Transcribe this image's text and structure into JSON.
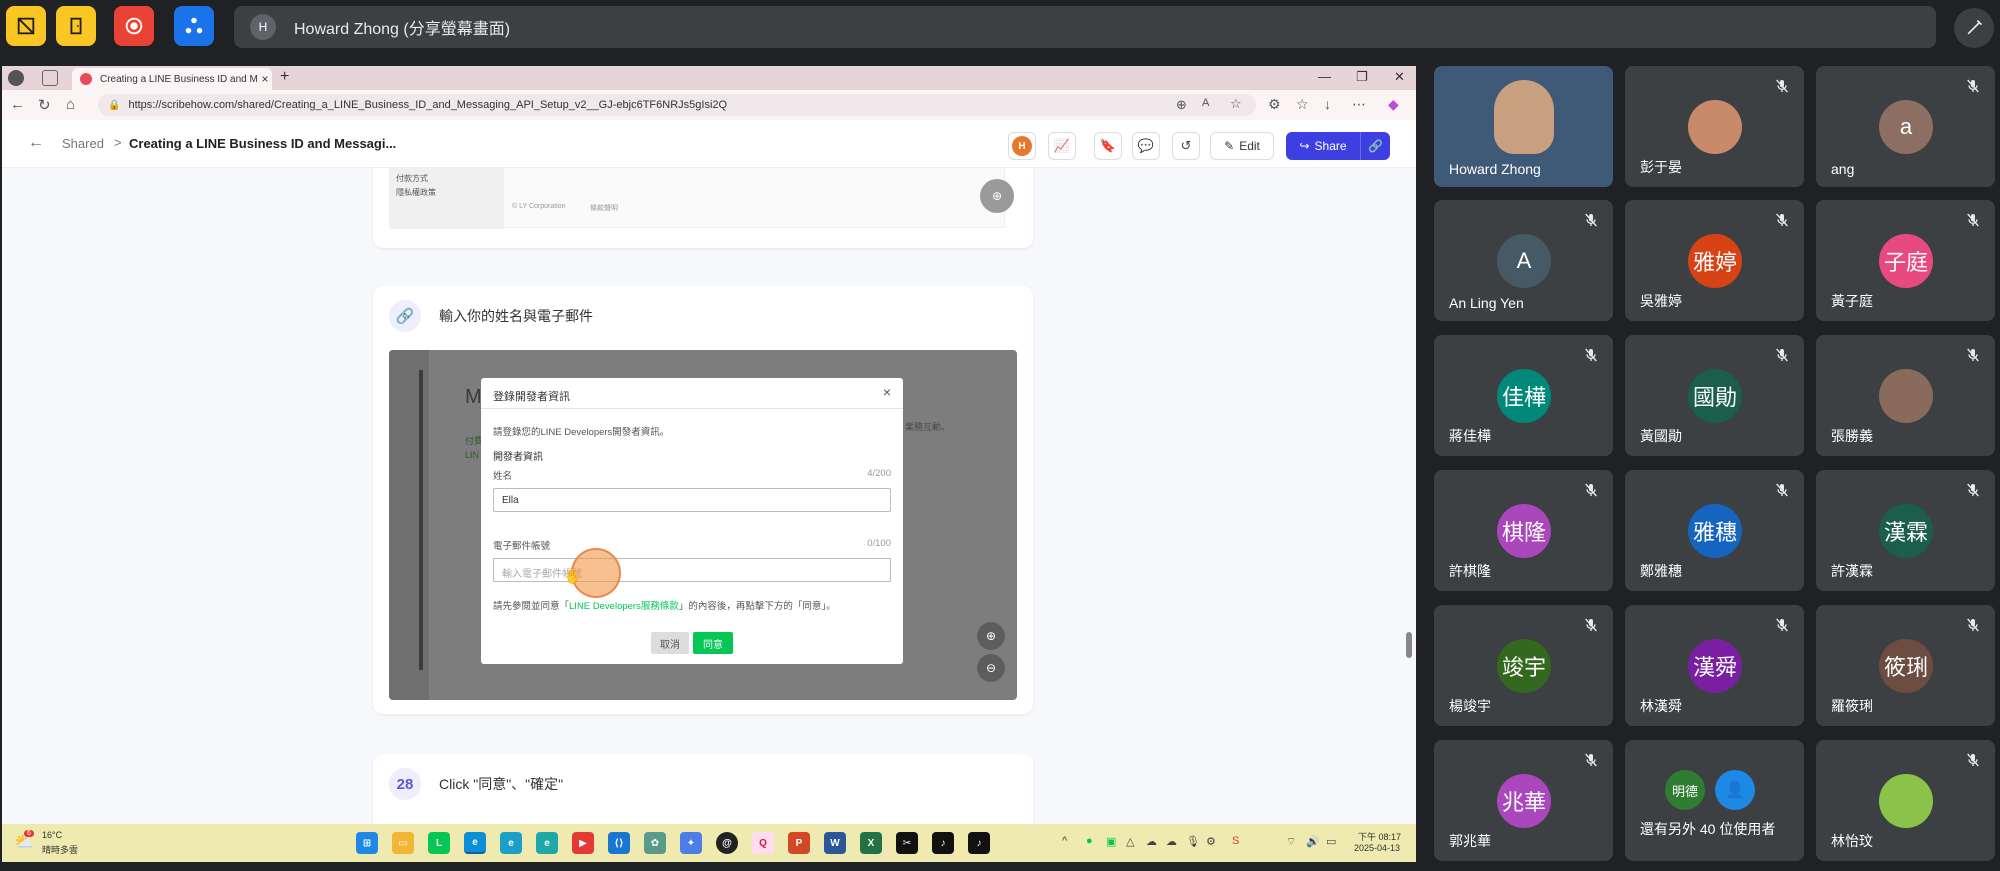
{
  "meet": {
    "presenter": "Howard Zhong (分享螢幕畫面)",
    "presenter_initial": "H"
  },
  "browser": {
    "tab_title": "Creating a LINE Business ID and M",
    "tab_close": "×",
    "new_tab": "+",
    "url": "https://scribehow.com/shared/Creating_a_LINE_Business_ID_and_Messaging_API_Setup_v2__GJ-ebjc6TF6NRJs5gIsi2Q"
  },
  "app": {
    "breadcrumb_root": "Shared",
    "breadcrumb_sep": ">",
    "breadcrumb_title": "Creating a LINE Business ID and Messagi...",
    "user_initial": "H",
    "edit_label": "Edit",
    "share_label": "Share"
  },
  "prev_step": {
    "line1": "付款方式",
    "line2": "隱私權政策",
    "line3": "© LY Corporation",
    "line4": "條款聲明"
  },
  "step_link": {
    "text": "輸入你的姓名與電子郵件"
  },
  "dialog": {
    "title": "登錄開發者資訊",
    "close": "×",
    "intro": "請登錄您的LINE Developers開發者資訊。",
    "section": "開發者資訊",
    "name_label": "姓名",
    "name_count": "4/200",
    "name_value": "Ella",
    "email_label": "電子郵件帳號",
    "email_count": "0/100",
    "email_placeholder": "輸入電子郵件帳號",
    "terms_pre": "請先參閱並同意「",
    "terms_link": "LINE Developers服務條款",
    "terms_post": "」的內容後，再點擊下方的「同意」。",
    "cancel": "取消",
    "agree": "同意"
  },
  "bg_page": {
    "heading": "M",
    "partial": "付費",
    "partial2": "LIN",
    "right": "業務互動。"
  },
  "step28": {
    "number": "28",
    "text": "Click \"同意\"、\"確定\""
  },
  "taskbar": {
    "temp": "16°C",
    "weather": "晴時多雲",
    "weather_badge": "6",
    "time": "下午 08:17",
    "date": "2025-04-13"
  },
  "participants": [
    {
      "name": "Howard Zhong",
      "initial": "",
      "color": "#3e5a77",
      "muted": false,
      "video": true
    },
    {
      "name": "彭于晏",
      "initial": "",
      "color": "#c98a6a",
      "muted": true,
      "photo": true
    },
    {
      "name": "ang",
      "initial": "a",
      "color": "#8d6e63",
      "muted": true
    },
    {
      "name": "An Ling Yen",
      "initial": "A",
      "color": "#455a64",
      "muted": true
    },
    {
      "name": "吳雅婷",
      "initial": "雅婷",
      "color": "#d84315",
      "muted": true
    },
    {
      "name": "黃子庭",
      "initial": "子庭",
      "color": "#e84a7f",
      "muted": true
    },
    {
      "name": "蔣佳樺",
      "initial": "佳樺",
      "color": "#00897b",
      "muted": true
    },
    {
      "name": "黃國勛",
      "initial": "國勛",
      "color": "#1b5e4b",
      "muted": true
    },
    {
      "name": "張勝義",
      "initial": "",
      "color": "#8a6a5a",
      "muted": true,
      "photo": true
    },
    {
      "name": "許棋隆",
      "initial": "棋隆",
      "color": "#ab47bc",
      "muted": true
    },
    {
      "name": "鄭雅穗",
      "initial": "雅穗",
      "color": "#1565c0",
      "muted": true
    },
    {
      "name": "許漢霖",
      "initial": "漢霖",
      "color": "#1b5e4b",
      "muted": true
    },
    {
      "name": "楊竣宇",
      "initial": "竣宇",
      "color": "#33691e",
      "muted": true
    },
    {
      "name": "林漢舜",
      "initial": "漢舜",
      "color": "#7b1fa2",
      "muted": true
    },
    {
      "name": "羅筱琍",
      "initial": "筱琍",
      "color": "#6d4c41",
      "muted": true
    },
    {
      "name": "郭兆華",
      "initial": "兆華",
      "color": "#ab47bc",
      "muted": true
    },
    {
      "name": "還有另外 40 位使用者",
      "initial": "明德",
      "color": "#2e7d32",
      "muted": false,
      "group": true
    },
    {
      "name": "林怡玟",
      "initial": "",
      "color": "#8bc34a",
      "muted": true,
      "photo": true
    }
  ],
  "colors": {
    "meet_bg": "#202124",
    "tile_bg": "#3c4043",
    "share_blue": "#3e3fe0",
    "line_green": "#06c755"
  }
}
